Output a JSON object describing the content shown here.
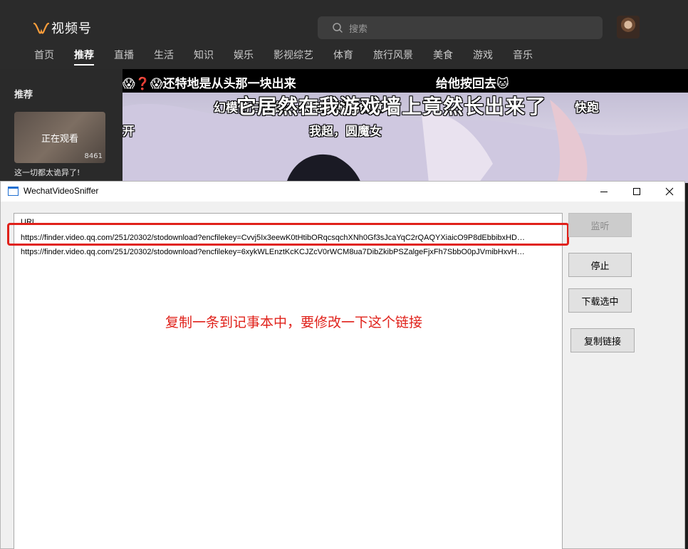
{
  "web": {
    "logo_text": "视频号",
    "search_placeholder": "搜索",
    "nav": [
      {
        "label": "首页",
        "active": false
      },
      {
        "label": "推荐",
        "active": true
      },
      {
        "label": "直播",
        "active": false
      },
      {
        "label": "生活",
        "active": false
      },
      {
        "label": "知识",
        "active": false
      },
      {
        "label": "娱乐",
        "active": false
      },
      {
        "label": "影视综艺",
        "active": false
      },
      {
        "label": "体育",
        "active": false
      },
      {
        "label": "旅行风景",
        "active": false
      },
      {
        "label": "美食",
        "active": false
      },
      {
        "label": "游戏",
        "active": false
      },
      {
        "label": "音乐",
        "active": false
      }
    ],
    "sidebar": {
      "title": "推荐",
      "watching": "正在观看",
      "count": "8461",
      "caption": "这一切都太诡异了!"
    },
    "subtitles": [
      "😱❓😱还特地是从头那一块出来",
      "给他按回去🐱",
      "它居然在我游戏墙上竟然长出来了",
      "幻模仿日本的一家电影游戏创意",
      "快跑",
      "开",
      "我超，圆魔女"
    ]
  },
  "window": {
    "title": "WechatVideoSniffer",
    "column_header": "URL",
    "urls": [
      "https://finder.video.qq.com/251/20302/stodownload?encfilekey=Cvvj5Ix3eewK0tHtibORqcsqchXNh0Gf3sJcaYqC2rQAQYXiaicO9P8dEbbibxHD…",
      "https://finder.video.qq.com/251/20302/stodownload?encfilekey=6xykWLEnztKcKCJZcV0rWCM8ua7DibZkibPSZalgeFjxFh7SbbO0pJVmibHxvH…"
    ],
    "buttons": {
      "listen": "监听",
      "stop": "停止",
      "download": "下载选中",
      "copy": "复制链接"
    },
    "annotation": "复制一条到记事本中，要修改一下这个链接"
  },
  "colors": {
    "annotation_red": "#e0211a",
    "accent_orange": "#fa9d3b"
  }
}
